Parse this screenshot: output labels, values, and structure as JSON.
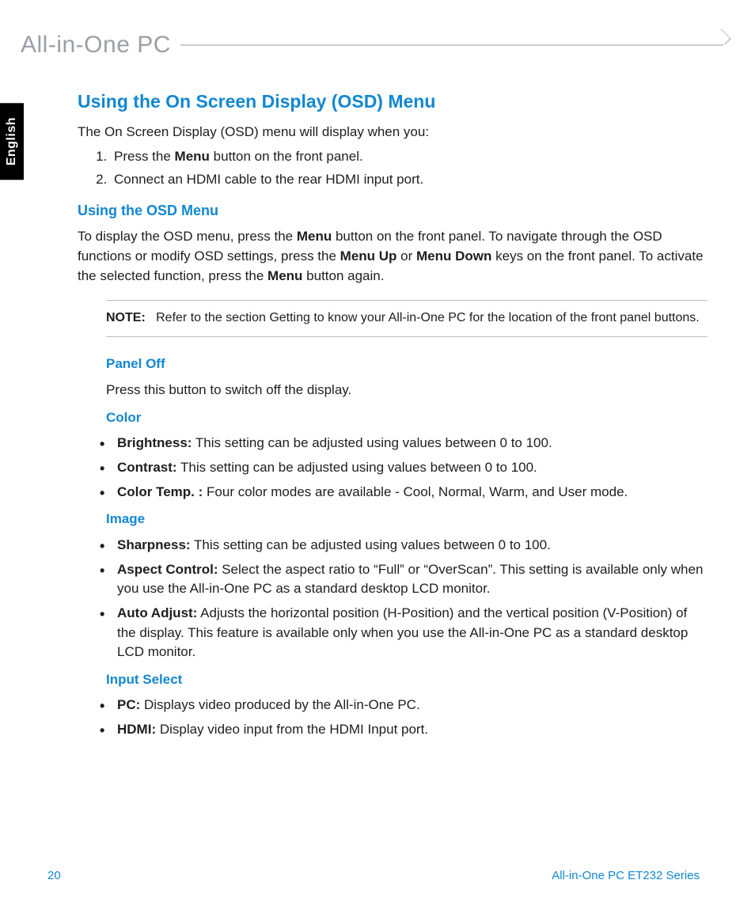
{
  "header": {
    "product": "All-in-One PC"
  },
  "langTab": "English",
  "main": {
    "title": "Using the On Screen Display (OSD) Menu",
    "intro": "The On Screen Display (OSD) menu will display when you:",
    "steps": [
      {
        "pre": "Press the ",
        "b": "Menu",
        "post": " button on the front panel."
      },
      {
        "pre": "Connect an HDMI cable to the rear HDMI input port.",
        "b": "",
        "post": ""
      }
    ],
    "sub1": {
      "title": "Using the OSD Menu",
      "seg1": "To display the OSD menu, press the ",
      "b1": "Menu",
      "seg2": " button on the front panel. To navigate through the OSD functions or modify OSD settings, press the ",
      "b2": "Menu Up",
      "seg3": " or ",
      "b3": "Menu Down",
      "seg4": " keys on the front panel. To activate the selected function, press the ",
      "b4": "Menu",
      "seg5": " button again."
    },
    "note": {
      "label": "NOTE:",
      "text": "Refer to the section Getting to know your All-in-One PC for the location of the front panel buttons."
    },
    "panelOff": {
      "title": "Panel Off",
      "text": "Press this button to switch off the display."
    },
    "color": {
      "title": "Color",
      "items": [
        {
          "b": "Brightness:",
          "t": " This setting can be adjusted using values between 0 to 100."
        },
        {
          "b": "Contrast:",
          "t": " This setting can be adjusted using values between 0 to 100."
        },
        {
          "b": "Color Temp. :",
          "t": " Four color modes are available - Cool, Normal, Warm, and User mode."
        }
      ]
    },
    "image": {
      "title": "Image",
      "items": [
        {
          "b": "Sharpness:",
          "t": " This setting can be adjusted using values between 0 to 100."
        },
        {
          "b": "Aspect Control:",
          "t": " Select the aspect ratio to “Full” or “OverScan”. This setting is available only when you use the All-in-One PC as a standard desktop LCD monitor."
        },
        {
          "b": "Auto Adjust:",
          "t": " Adjusts the horizontal position (H-Position) and the vertical position (V-Position) of the display. This feature is available only when you use the All-in-One PC as a standard desktop LCD monitor."
        }
      ]
    },
    "input": {
      "title": "Input Select",
      "items": [
        {
          "b": "PC:",
          "t": " Displays video produced by the All-in-One PC."
        },
        {
          "b": "HDMI:",
          "t": " Display video input from the HDMI Input port."
        }
      ]
    }
  },
  "footer": {
    "page": "20",
    "series": "All-in-One PC ET232 Series"
  }
}
